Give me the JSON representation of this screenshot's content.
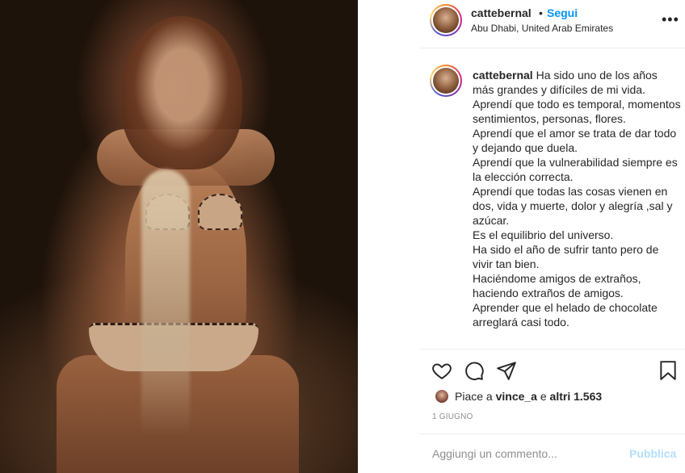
{
  "post": {
    "username": "cattebernal",
    "separator": "•",
    "follow_label": "Segui",
    "location": "Abu Dhabi, United Arab Emirates",
    "more_label": "•••",
    "caption_username": "cattebernal",
    "caption_text": " Ha sido uno de los años más grandes y difíciles de mi vida.\nAprendí que todo es temporal, momentos sentimientos, personas, flores.\nAprendí que el amor se trata de dar todo y dejando que duela.\nAprendí que la vulnerabilidad siempre es la elección correcta.\nAprendí que todas las cosas vienen en dos, vida y muerte, dolor y alegría ,sal y azúcar.\nEs el equilibrio del universo.\nHa sido el año de sufrir tanto pero de vivir tan bien.\nHaciéndome amigos de extraños, haciendo extraños de amigos.\nAprender que el helado de chocolate arreglará casi todo.",
    "likes": {
      "prefix": "Piace a ",
      "user": "vince_a",
      "middle": " e ",
      "others": "altri 1.563"
    },
    "date": "1 GIUGNO",
    "comment_placeholder": "Aggiungi un commento...",
    "publish_label": "Pubblica"
  },
  "icons": [
    "heart-icon",
    "comment-icon",
    "share-icon",
    "bookmark-icon",
    "more-options-icon"
  ],
  "colors": {
    "link_blue": "#0095f6",
    "publish_disabled": "#b2dffc",
    "text": "#262626",
    "muted": "#8e8e8e",
    "border": "#efefef"
  }
}
